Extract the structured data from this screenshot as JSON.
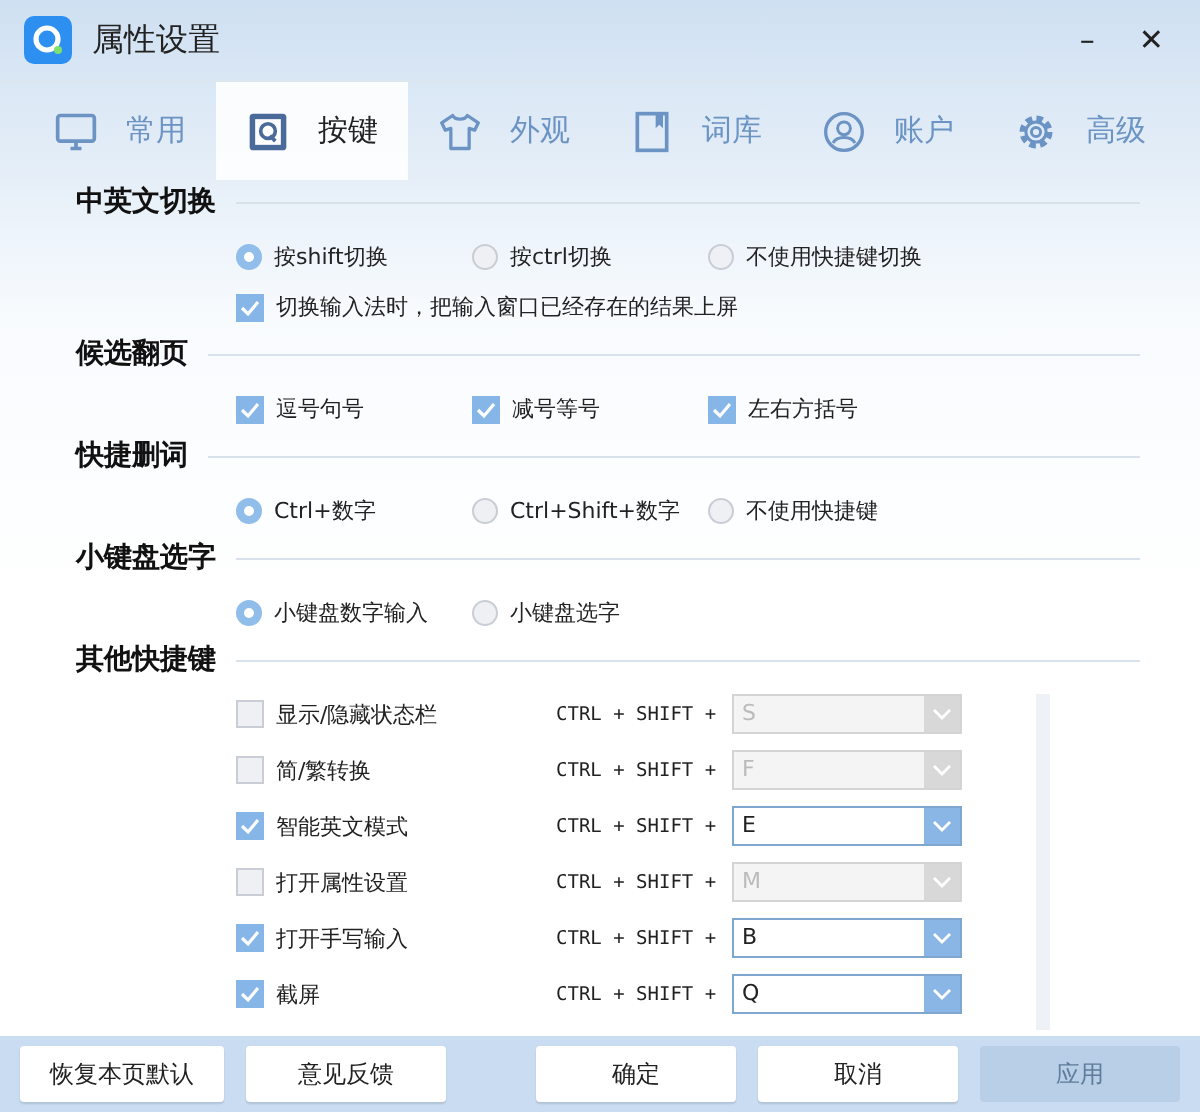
{
  "window": {
    "title": "属性设置",
    "minimize": "–",
    "close": "✕"
  },
  "tabs": [
    {
      "label": "常用",
      "kind": "monitor",
      "selected": false
    },
    {
      "label": "按键",
      "kind": "key",
      "selected": true
    },
    {
      "label": "外观",
      "kind": "shirt",
      "selected": false
    },
    {
      "label": "词库",
      "kind": "book",
      "selected": false
    },
    {
      "label": "账户",
      "kind": "user",
      "selected": false
    },
    {
      "label": "高级",
      "kind": "gear",
      "selected": false
    }
  ],
  "sections": [
    {
      "title": "中英文切换",
      "rows": [
        [
          {
            "kind": "radio",
            "label": "按shift切换",
            "selected": true
          },
          {
            "kind": "radio",
            "label": "按ctrl切换",
            "selected": false
          },
          {
            "kind": "radio",
            "label": "不使用快捷键切换",
            "selected": false
          }
        ],
        [
          {
            "kind": "checkbox",
            "label": "切换输入法时，把输入窗口已经存在的结果上屏",
            "checked": true
          }
        ]
      ]
    },
    {
      "title": "候选翻页",
      "rows": [
        [
          {
            "kind": "checkbox",
            "label": "逗号句号",
            "checked": true
          },
          {
            "kind": "checkbox",
            "label": "减号等号",
            "checked": true
          },
          {
            "kind": "checkbox",
            "label": "左右方括号",
            "checked": true
          }
        ]
      ]
    },
    {
      "title": "快捷删词",
      "rows": [
        [
          {
            "kind": "radio",
            "label": "Ctrl+数字",
            "selected": true
          },
          {
            "kind": "radio",
            "label": "Ctrl+Shift+数字",
            "selected": false
          },
          {
            "kind": "radio",
            "label": "不使用快捷键",
            "selected": false
          }
        ]
      ]
    },
    {
      "title": "小键盘选字",
      "rows": [
        [
          {
            "kind": "radio",
            "label": "小键盘数字输入",
            "selected": true
          },
          {
            "kind": "radio",
            "label": "小键盘选字",
            "selected": false
          }
        ]
      ]
    },
    {
      "title": "其他快捷键",
      "shortcuts": [
        {
          "label": "显示/隐藏状态栏",
          "checked": false,
          "prefix": "CTRL + SHIFT +",
          "key": "S"
        },
        {
          "label": "简/繁转换",
          "checked": false,
          "prefix": "CTRL + SHIFT +",
          "key": "F"
        },
        {
          "label": "智能英文模式",
          "checked": true,
          "prefix": "CTRL + SHIFT +",
          "key": "E"
        },
        {
          "label": "打开属性设置",
          "checked": false,
          "prefix": "CTRL + SHIFT +",
          "key": "M"
        },
        {
          "label": "打开手写输入",
          "checked": true,
          "prefix": "CTRL + SHIFT +",
          "key": "B"
        },
        {
          "label": "截屏",
          "checked": true,
          "prefix": "CTRL + SHIFT +",
          "key": "Q"
        }
      ]
    }
  ],
  "footer": {
    "left": [
      "恢复本页默认",
      "意见反馈"
    ],
    "right": [
      {
        "label": "确定",
        "disabled": false
      },
      {
        "label": "取消",
        "disabled": false
      },
      {
        "label": "应用",
        "disabled": true
      }
    ]
  }
}
